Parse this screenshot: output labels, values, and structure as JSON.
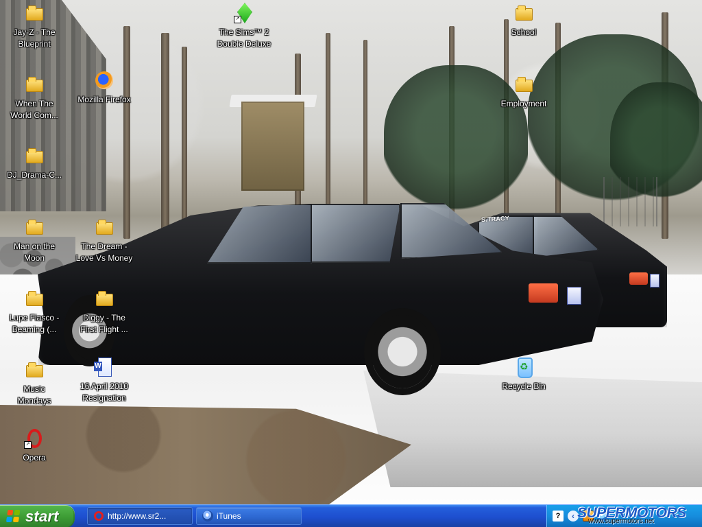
{
  "desktop": {
    "icons": {
      "jay_z": {
        "label": "Jay-Z - The\nBlueprint",
        "icon": "folder-icon"
      },
      "sims": {
        "label": "The Sims™ 2\nDouble Deluxe",
        "icon": "sims-icon"
      },
      "school": {
        "label": "School",
        "icon": "folder-icon"
      },
      "when_the_world": {
        "label": "When The\nWorld Com...",
        "icon": "folder-icon"
      },
      "firefox": {
        "label": "Mozilla Firefox",
        "icon": "firefox-icon"
      },
      "employment": {
        "label": "Employment",
        "icon": "folder-icon"
      },
      "dj_drama": {
        "label": "DJ_Drama-C...",
        "icon": "folder-icon"
      },
      "man_on_the_moon": {
        "label": "Man on the\nMoon",
        "icon": "folder-icon"
      },
      "dream": {
        "label": "The Dream -\nLove Vs Money",
        "icon": "folder-icon"
      },
      "lupe": {
        "label": "Lupe Fiasco -\nBeaming (...",
        "icon": "folder-icon"
      },
      "diggy": {
        "label": "Diggy - The\nFirst Flight ...",
        "icon": "folder-icon"
      },
      "music_mondays": {
        "label": "Music\nMondays",
        "icon": "folder-icon"
      },
      "resignation": {
        "label": "16 April 2010\nResignation",
        "icon": "word-document-icon"
      },
      "recycle_bin": {
        "label": "Recycle Bin",
        "icon": "recycle-bin-icon"
      },
      "opera": {
        "label": "Opera",
        "icon": "opera-icon"
      }
    },
    "wallpaper": {
      "window_sticker": "S.TRACY"
    }
  },
  "taskbar": {
    "start_label": "start",
    "items": [
      {
        "label": "http://www.sr2...",
        "icon": "opera-icon"
      },
      {
        "label": "iTunes",
        "icon": "itunes-icon"
      }
    ],
    "tray_icons": [
      "help-icon",
      "arrow-icon",
      "warning-icon",
      "globe-icon"
    ]
  },
  "watermark": {
    "brand": "SUPERMOTORS",
    "url": "www.supermotors.net"
  }
}
